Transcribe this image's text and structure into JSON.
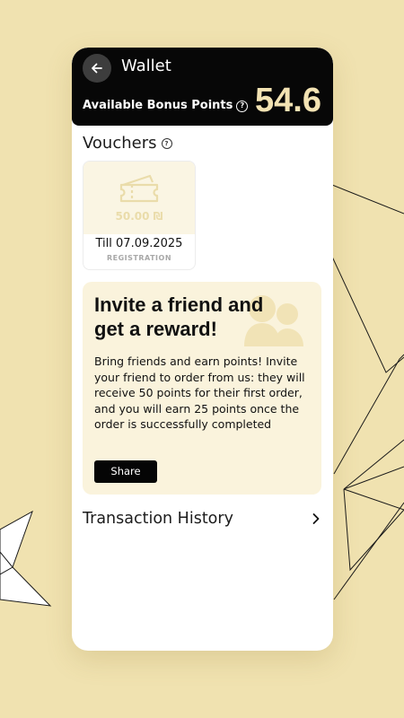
{
  "header": {
    "title": "Wallet",
    "points_label": "Available Bonus Points",
    "points_value": "54.6"
  },
  "vouchers": {
    "title": "Vouchers",
    "items": [
      {
        "amount": "50.00 ₪",
        "valid_till": "Till 07.09.2025",
        "source": "REGISTRATION"
      }
    ]
  },
  "invite": {
    "title": "Invite a friend and get a reward!",
    "body": "Bring friends and earn points! Invite your friend to order from us: they will receive 50 points for their first order, and you will earn 25 points once the order is successfully completed",
    "share_label": "Share"
  },
  "history": {
    "label": "Transaction History"
  },
  "icons": {
    "back": "arrow-left-icon",
    "help": "question-circle-icon",
    "voucher": "ticket-icon",
    "invite": "people-icon",
    "history": "chevron-right-icon"
  },
  "colors": {
    "background": "#f0e2b0",
    "header": "#070707",
    "points_accent": "#f3e3b3",
    "invite_card": "#faf3dc",
    "button": "#050505"
  }
}
